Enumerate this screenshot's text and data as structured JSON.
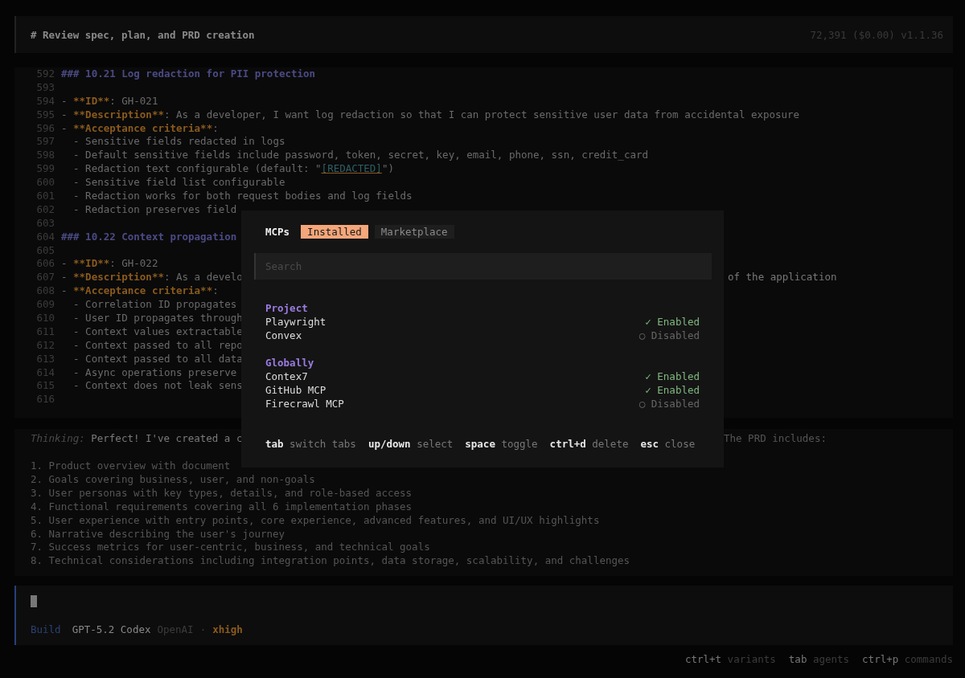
{
  "header": {
    "title": "# Review spec, plan, and PRD creation",
    "stats": "72,391 ($0.00) v1.1.36"
  },
  "code_lines": [
    {
      "num": "592",
      "segments": [
        {
          "kind": "heading",
          "text": "### 10.21 Log redaction for PII protection"
        }
      ]
    },
    {
      "num": "593"
    },
    {
      "num": "594",
      "segments": [
        {
          "kind": "plain",
          "text": "- "
        },
        {
          "kind": "key",
          "text": "**ID**"
        },
        {
          "kind": "plain",
          "text": ": GH-021"
        }
      ]
    },
    {
      "num": "595",
      "segments": [
        {
          "kind": "plain",
          "text": "- "
        },
        {
          "kind": "key",
          "text": "**Description**"
        },
        {
          "kind": "plain",
          "text": ": As a developer, I want log redaction so that I can protect sensitive user data from accidental exposure"
        }
      ]
    },
    {
      "num": "596",
      "segments": [
        {
          "kind": "plain",
          "text": "- "
        },
        {
          "kind": "key",
          "text": "**Acceptance criteria**"
        },
        {
          "kind": "plain",
          "text": ":"
        }
      ]
    },
    {
      "num": "597",
      "segments": [
        {
          "kind": "plain",
          "text": "  - Sensitive fields redacted in logs"
        }
      ]
    },
    {
      "num": "598",
      "segments": [
        {
          "kind": "plain",
          "text": "  - Default sensitive fields include password, token, secret, key, email, phone, ssn, credit_card"
        }
      ]
    },
    {
      "num": "599",
      "segments": [
        {
          "kind": "plain",
          "text": "  - Redaction text configurable (default: \""
        },
        {
          "kind": "link",
          "text": "[REDACTED]"
        },
        {
          "kind": "plain",
          "text": "\")"
        }
      ]
    },
    {
      "num": "600",
      "segments": [
        {
          "kind": "plain",
          "text": "  - Sensitive field list configurable"
        }
      ]
    },
    {
      "num": "601",
      "segments": [
        {
          "kind": "plain",
          "text": "  - Redaction works for both request bodies and log fields"
        }
      ]
    },
    {
      "num": "602",
      "segments": [
        {
          "kind": "plain",
          "text": "  - Redaction preserves field"
        }
      ]
    },
    {
      "num": "603"
    },
    {
      "num": "604",
      "segments": [
        {
          "kind": "heading",
          "text": "### 10.22 Context propagation"
        }
      ]
    },
    {
      "num": "605"
    },
    {
      "num": "606",
      "segments": [
        {
          "kind": "plain",
          "text": "- "
        },
        {
          "kind": "key",
          "text": "**ID**"
        },
        {
          "kind": "plain",
          "text": ": GH-022"
        }
      ]
    },
    {
      "num": "607",
      "segments": [
        {
          "kind": "plain",
          "text": "- "
        },
        {
          "kind": "key",
          "text": "**Description**"
        },
        {
          "kind": "plain",
          "text": ": As a develo"
        }
      ],
      "tail": "of the application"
    },
    {
      "num": "608",
      "segments": [
        {
          "kind": "plain",
          "text": "- "
        },
        {
          "kind": "key",
          "text": "**Acceptance criteria**"
        },
        {
          "kind": "plain",
          "text": ":"
        }
      ]
    },
    {
      "num": "609",
      "segments": [
        {
          "kind": "plain",
          "text": "  - Correlation ID propagates"
        }
      ]
    },
    {
      "num": "610",
      "segments": [
        {
          "kind": "plain",
          "text": "  - User ID propagates through"
        }
      ]
    },
    {
      "num": "611",
      "segments": [
        {
          "kind": "plain",
          "text": "  - Context values extractable"
        }
      ]
    },
    {
      "num": "612",
      "segments": [
        {
          "kind": "plain",
          "text": "  - Context passed to all repo"
        }
      ]
    },
    {
      "num": "613",
      "segments": [
        {
          "kind": "plain",
          "text": "  - Context passed to all data"
        }
      ]
    },
    {
      "num": "614",
      "segments": [
        {
          "kind": "plain",
          "text": "  - Async operations preserve"
        }
      ]
    },
    {
      "num": "615",
      "segments": [
        {
          "kind": "plain",
          "text": "  - Context does not leak sens"
        }
      ]
    },
    {
      "num": "616"
    }
  ],
  "thinking": {
    "label": "Thinking:",
    "text": "Perfect! I've created a c",
    "tail": "The PRD includes:",
    "items": [
      "1. Product overview with document",
      "2. Goals covering business, user, and non-goals",
      "3. User personas with key types, details, and role-based access",
      "4. Functional requirements covering all 6 implementation phases",
      "5. User experience with entry points, core experience, advanced features, and UI/UX highlights",
      "6. Narrative describing the user's journey",
      "7. Success metrics for user-centric, business, and technical goals",
      "8. Technical considerations including integration points, data storage, scalability, and challenges"
    ]
  },
  "prompt": {
    "agent": "Build",
    "model": "GPT-5.2 Codex",
    "provider": "OpenAI",
    "separator": "·",
    "variant": "xhigh"
  },
  "footer_hints": [
    {
      "key": "ctrl+t",
      "label": "variants"
    },
    {
      "key": "tab",
      "label": "agents"
    },
    {
      "key": "ctrl+p",
      "label": "commands"
    }
  ],
  "dialog": {
    "title": "MCPs",
    "tabs": [
      {
        "label": "Installed",
        "selected": true
      },
      {
        "label": "Marketplace",
        "selected": false
      }
    ],
    "search": {
      "placeholder": "Search"
    },
    "groups": [
      {
        "name": "Project",
        "items": [
          {
            "name": "Playwright",
            "mark": "✓",
            "status": "Enabled",
            "enabled": true
          },
          {
            "name": "Convex",
            "mark": "○",
            "status": "Disabled",
            "enabled": false
          }
        ]
      },
      {
        "name": "Globally",
        "items": [
          {
            "name": "Contex7",
            "mark": "✓",
            "status": "Enabled",
            "enabled": true
          },
          {
            "name": "GitHub MCP",
            "mark": "✓",
            "status": "Enabled",
            "enabled": true
          },
          {
            "name": "Firecrawl MCP",
            "mark": "○",
            "status": "Disabled",
            "enabled": false
          }
        ]
      }
    ],
    "hints": [
      {
        "key": "tab",
        "label": "switch tabs"
      },
      {
        "key": "up/down",
        "label": "select"
      },
      {
        "key": "space",
        "label": "toggle"
      },
      {
        "key": "ctrl+d",
        "label": "delete"
      },
      {
        "key": "esc",
        "label": "close"
      }
    ]
  }
}
